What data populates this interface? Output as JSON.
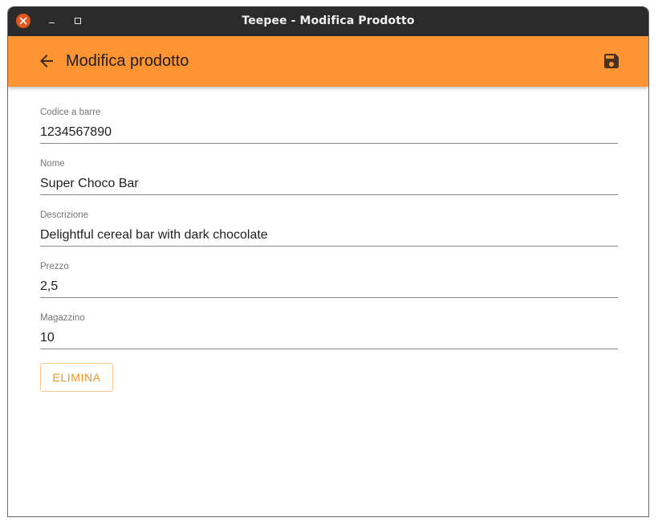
{
  "window": {
    "title": "Teepee - Modifica Prodotto"
  },
  "appbar": {
    "title": "Modifica prodotto",
    "back_icon": "arrow-back-icon",
    "save_icon": "floppy-disk-icon",
    "color": "#ff9433"
  },
  "form": {
    "fields": [
      {
        "label": "Codice a barre",
        "value": "1234567890"
      },
      {
        "label": "Nome",
        "value": "Super Choco Bar"
      },
      {
        "label": "Descrizione",
        "value": "Delightful cereal bar with dark chocolate"
      },
      {
        "label": "Prezzo",
        "value": "2,5"
      },
      {
        "label": "Magazzino",
        "value": "10"
      }
    ],
    "delete_label": "ELIMINA",
    "accent_color": "#f7921e"
  }
}
